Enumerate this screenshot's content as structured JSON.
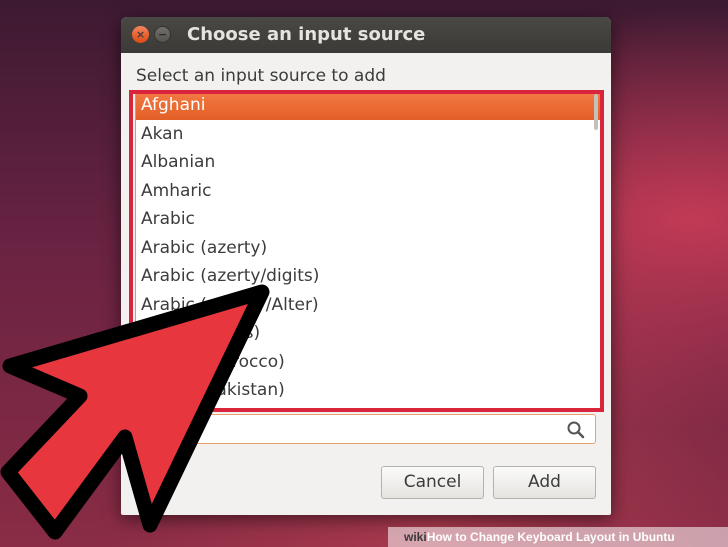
{
  "dialog": {
    "title": "Choose an input source",
    "close_glyph": "×",
    "minimize_glyph": "−",
    "prompt": "Select an input source to add",
    "items": [
      "Afghani",
      "Akan",
      "Albanian",
      "Amharic",
      "Arabic",
      "Arabic (azerty)",
      "Arabic (azerty/digits)",
      "Arabic (qwerty/Alter)",
      "Arabic (digits)",
      "Arabic (Morocco)",
      "Arabic (Pakistan)"
    ],
    "selected_index": 0,
    "search": {
      "value": "",
      "icon": "search-icon"
    },
    "cancel_label": "Cancel",
    "add_label": "Add"
  },
  "footer": {
    "brand": "wiki",
    "how": "How",
    "text": " to Change Keyboard Layout in Ubuntu"
  },
  "colors": {
    "selection": "#e8682f",
    "highlight_box": "#d8253c",
    "arrow_fill": "#e8363e",
    "arrow_stroke": "#000000"
  }
}
